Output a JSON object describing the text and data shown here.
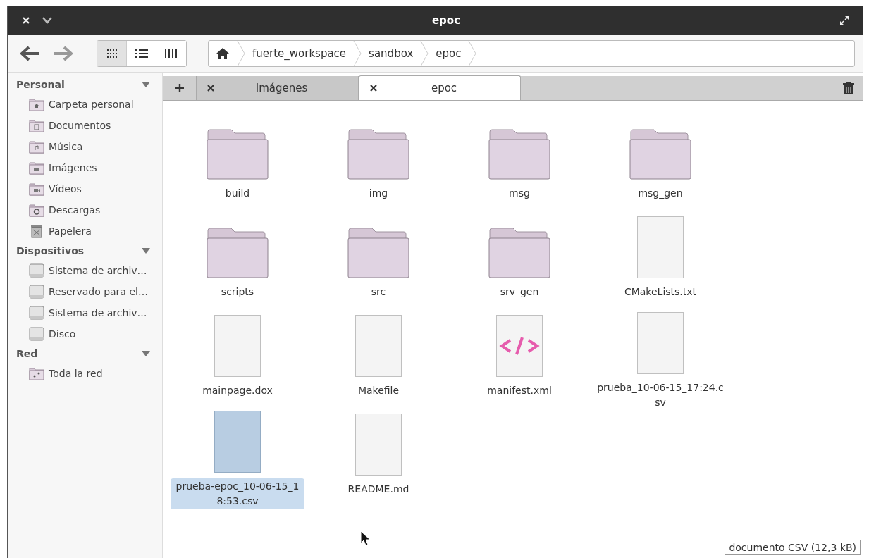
{
  "window": {
    "title": "epoc"
  },
  "toolbar": {
    "view_modes": [
      {
        "kind": "icons",
        "selected": true
      },
      {
        "kind": "list",
        "selected": false
      },
      {
        "kind": "columns",
        "selected": false
      }
    ],
    "breadcrumbs": [
      "fuerte_workspace",
      "sandbox",
      "epoc"
    ]
  },
  "sidebar": {
    "sections": [
      {
        "title": "Personal",
        "expanded": true,
        "items": [
          {
            "label": "Carpeta personal",
            "kind": "home"
          },
          {
            "label": "Documentos",
            "kind": "documents"
          },
          {
            "label": "Música",
            "kind": "music"
          },
          {
            "label": "Imágenes",
            "kind": "pictures"
          },
          {
            "label": "Vídeos",
            "kind": "videos"
          },
          {
            "label": "Descargas",
            "kind": "downloads"
          },
          {
            "label": "Papelera",
            "kind": "trash"
          }
        ]
      },
      {
        "title": "Dispositivos",
        "expanded": true,
        "items": [
          {
            "label": "Sistema de archiv…",
            "kind": "drive"
          },
          {
            "label": "Reservado para el…",
            "kind": "drive"
          },
          {
            "label": "Sistema de archiv…",
            "kind": "drive"
          },
          {
            "label": "Disco",
            "kind": "drive"
          }
        ]
      },
      {
        "title": "Red",
        "expanded": true,
        "items": [
          {
            "label": "Toda la red",
            "kind": "network"
          }
        ]
      }
    ]
  },
  "tabs": [
    {
      "label": "Imágenes",
      "selected": false
    },
    {
      "label": "epoc",
      "selected": true
    }
  ],
  "files": [
    {
      "name": "build",
      "kind": "folder",
      "selected": false
    },
    {
      "name": "img",
      "kind": "folder",
      "selected": false
    },
    {
      "name": "msg",
      "kind": "folder",
      "selected": false
    },
    {
      "name": "msg_gen",
      "kind": "folder",
      "selected": false
    },
    {
      "name": "scripts",
      "kind": "folder",
      "selected": false
    },
    {
      "name": "src",
      "kind": "folder",
      "selected": false
    },
    {
      "name": "srv_gen",
      "kind": "folder",
      "selected": false
    },
    {
      "name": "CMakeLists.txt",
      "kind": "file",
      "selected": false
    },
    {
      "name": "mainpage.dox",
      "kind": "file",
      "selected": false
    },
    {
      "name": "Makefile",
      "kind": "file",
      "selected": false
    },
    {
      "name": "manifest.xml",
      "kind": "xml",
      "selected": false
    },
    {
      "name": "prueba_10-06-15_17:24.csv",
      "kind": "file",
      "selected": false
    },
    {
      "name": "prueba-epoc_10-06-15_18:53.csv",
      "kind": "file",
      "selected": true
    },
    {
      "name": "README.md",
      "kind": "file",
      "selected": false
    }
  ],
  "tooltip": "documento CSV (12,3 kB)"
}
